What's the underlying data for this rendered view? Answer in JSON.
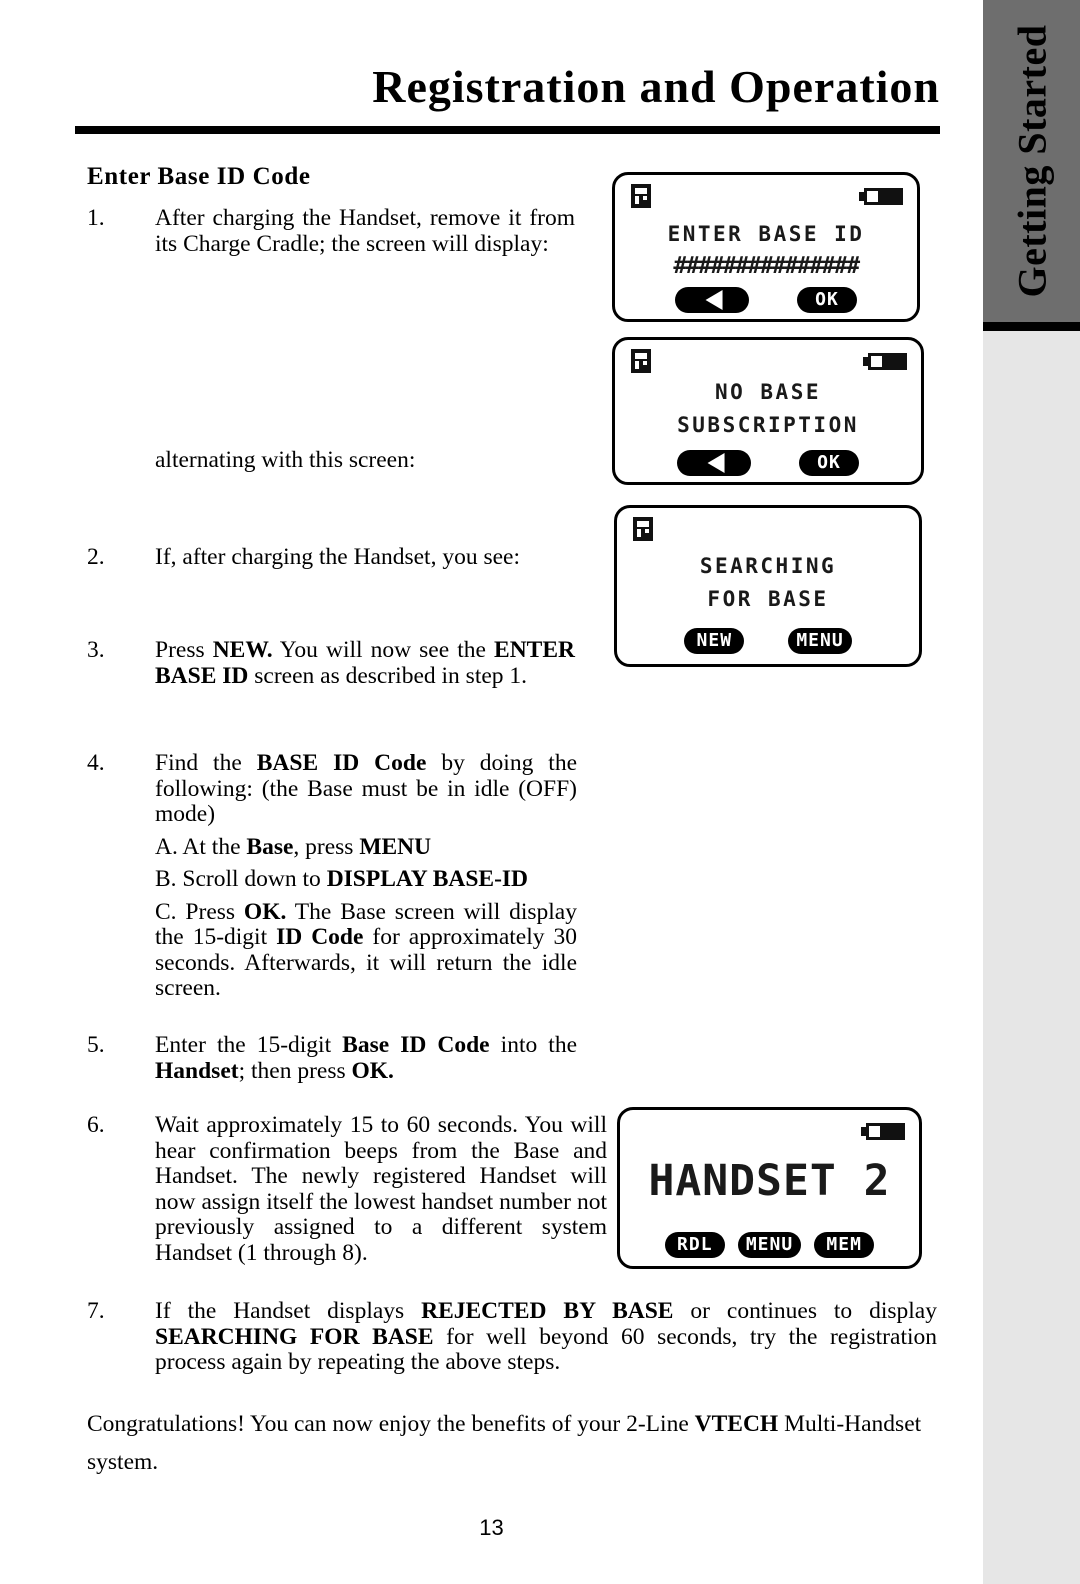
{
  "header": {
    "title": "Registration and Operation",
    "side_tab": "Getting Started"
  },
  "section": {
    "heading": "Enter Base ID Code"
  },
  "steps": [
    {
      "number": "1.",
      "text": "After charging the Handset, remove it from its Charge Cradle; the screen will display:"
    },
    {
      "number": "2.",
      "text": "If, after charging the Handset, you see:"
    },
    {
      "number": "3.",
      "text_before": "Press ",
      "bold_1": "NEW.",
      "text_mid": " You will now see the ",
      "bold_2": "ENTER BASE ID",
      "text_after": " screen as described in step 1."
    },
    {
      "number": "4.",
      "text_before": "Find the ",
      "bold_1": "BASE ID Code",
      "text_after": " by doing the following: (the Base must be in idle (OFF) mode)",
      "sub_a_before": "A. At the ",
      "sub_a_bold": "Base",
      "sub_a_mid": ", press ",
      "sub_a_bold2": "MENU",
      "sub_b_before": "B. Scroll down to ",
      "sub_b_bold": "DISPLAY BASE-ID",
      "sub_c_before": "C. Press ",
      "sub_c_bold": "OK.",
      "sub_c_mid": " The Base screen will display the 15-digit ",
      "sub_c_bold2": "ID Code",
      "sub_c_after": " for approximately 30 seconds. Afterwards, it will return the idle screen."
    },
    {
      "number": "5.",
      "text_before": "Enter the 15-digit ",
      "bold_1": "Base ID Code",
      "text_mid": " into the ",
      "bold_2": "Handset",
      "text_mid2": "; then press ",
      "bold_3": "OK."
    },
    {
      "number": "6.",
      "text": "Wait approximately 15 to 60 seconds. You will hear confirmation beeps from the Base and Handset. The newly registered Handset will now assign itself the lowest handset number not previously assigned to a different system Handset (1 through 8)."
    },
    {
      "number": "7.",
      "text_before": "If the Handset displays ",
      "bold_1": "REJECTED BY BASE",
      "text_mid": " or continues to display ",
      "bold_2": "SEARCHING FOR BASE",
      "text_after": " for well beyond 60 seconds, try the registration process again by repeating the above steps."
    }
  ],
  "notes": {
    "alternating": "alternating with this screen:"
  },
  "outro": {
    "text_before": "Congratulations!  You can now enjoy the benefits of your 2-Line ",
    "bold_1": "VTECH",
    "text_after": " Multi-Handset system."
  },
  "screens": [
    {
      "name": "enter-base-id",
      "icons": [
        "antenna-icon",
        "battery-icon"
      ],
      "line1": "ENTER BASE ID",
      "line2": "###############",
      "softkeys": [
        "back-arrow",
        "OK"
      ]
    },
    {
      "name": "no-base-subscription",
      "icons": [
        "antenna-icon",
        "battery-icon"
      ],
      "line1": "NO BASE",
      "line2": "SUBSCRIPTION",
      "softkeys": [
        "back-arrow",
        "OK"
      ]
    },
    {
      "name": "searching-for-base",
      "icons": [
        "antenna-icon"
      ],
      "line1": "SEARCHING",
      "line2": "FOR BASE",
      "softkeys": [
        "NEW",
        "MENU"
      ]
    },
    {
      "name": "handset-idle",
      "icons": [
        "battery-icon"
      ],
      "line1": "HANDSET 2",
      "softkeys": [
        "RDL",
        "MENU",
        "MEM"
      ]
    }
  ],
  "footer": {
    "page_number": "13"
  },
  "colors": {
    "tab_gray": "#6e6e6e",
    "strip_gray": "#e6e6e6",
    "ink": "#000000"
  }
}
